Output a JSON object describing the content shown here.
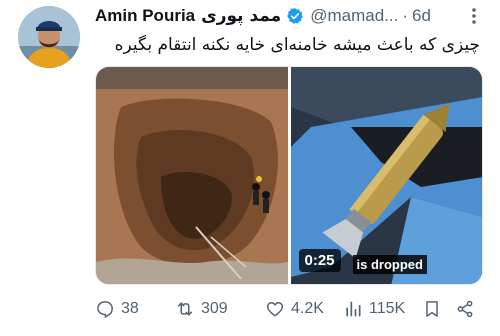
{
  "tweet": {
    "author_name": "Amin Pouria",
    "author_name_fa": "ممد پوری",
    "handle": "@mamad...",
    "separator": "·",
    "time": "6d",
    "text": "چیزی که باعث میشه خامنه‌ای خایه نکنه انتقام بگیره"
  },
  "media": {
    "video_duration": "0:25",
    "video_caption": "is dropped"
  },
  "actions": {
    "replies": "38",
    "reposts": "309",
    "likes": "4.2K",
    "views": "115K"
  },
  "colors": {
    "text": "#0f1419",
    "muted": "#536471",
    "verified": "#1d9bf0"
  },
  "icons": [
    "verified-badge-icon",
    "more-options-icon",
    "reply-icon",
    "repost-icon",
    "like-icon",
    "views-icon",
    "bookmark-icon",
    "share-icon"
  ]
}
